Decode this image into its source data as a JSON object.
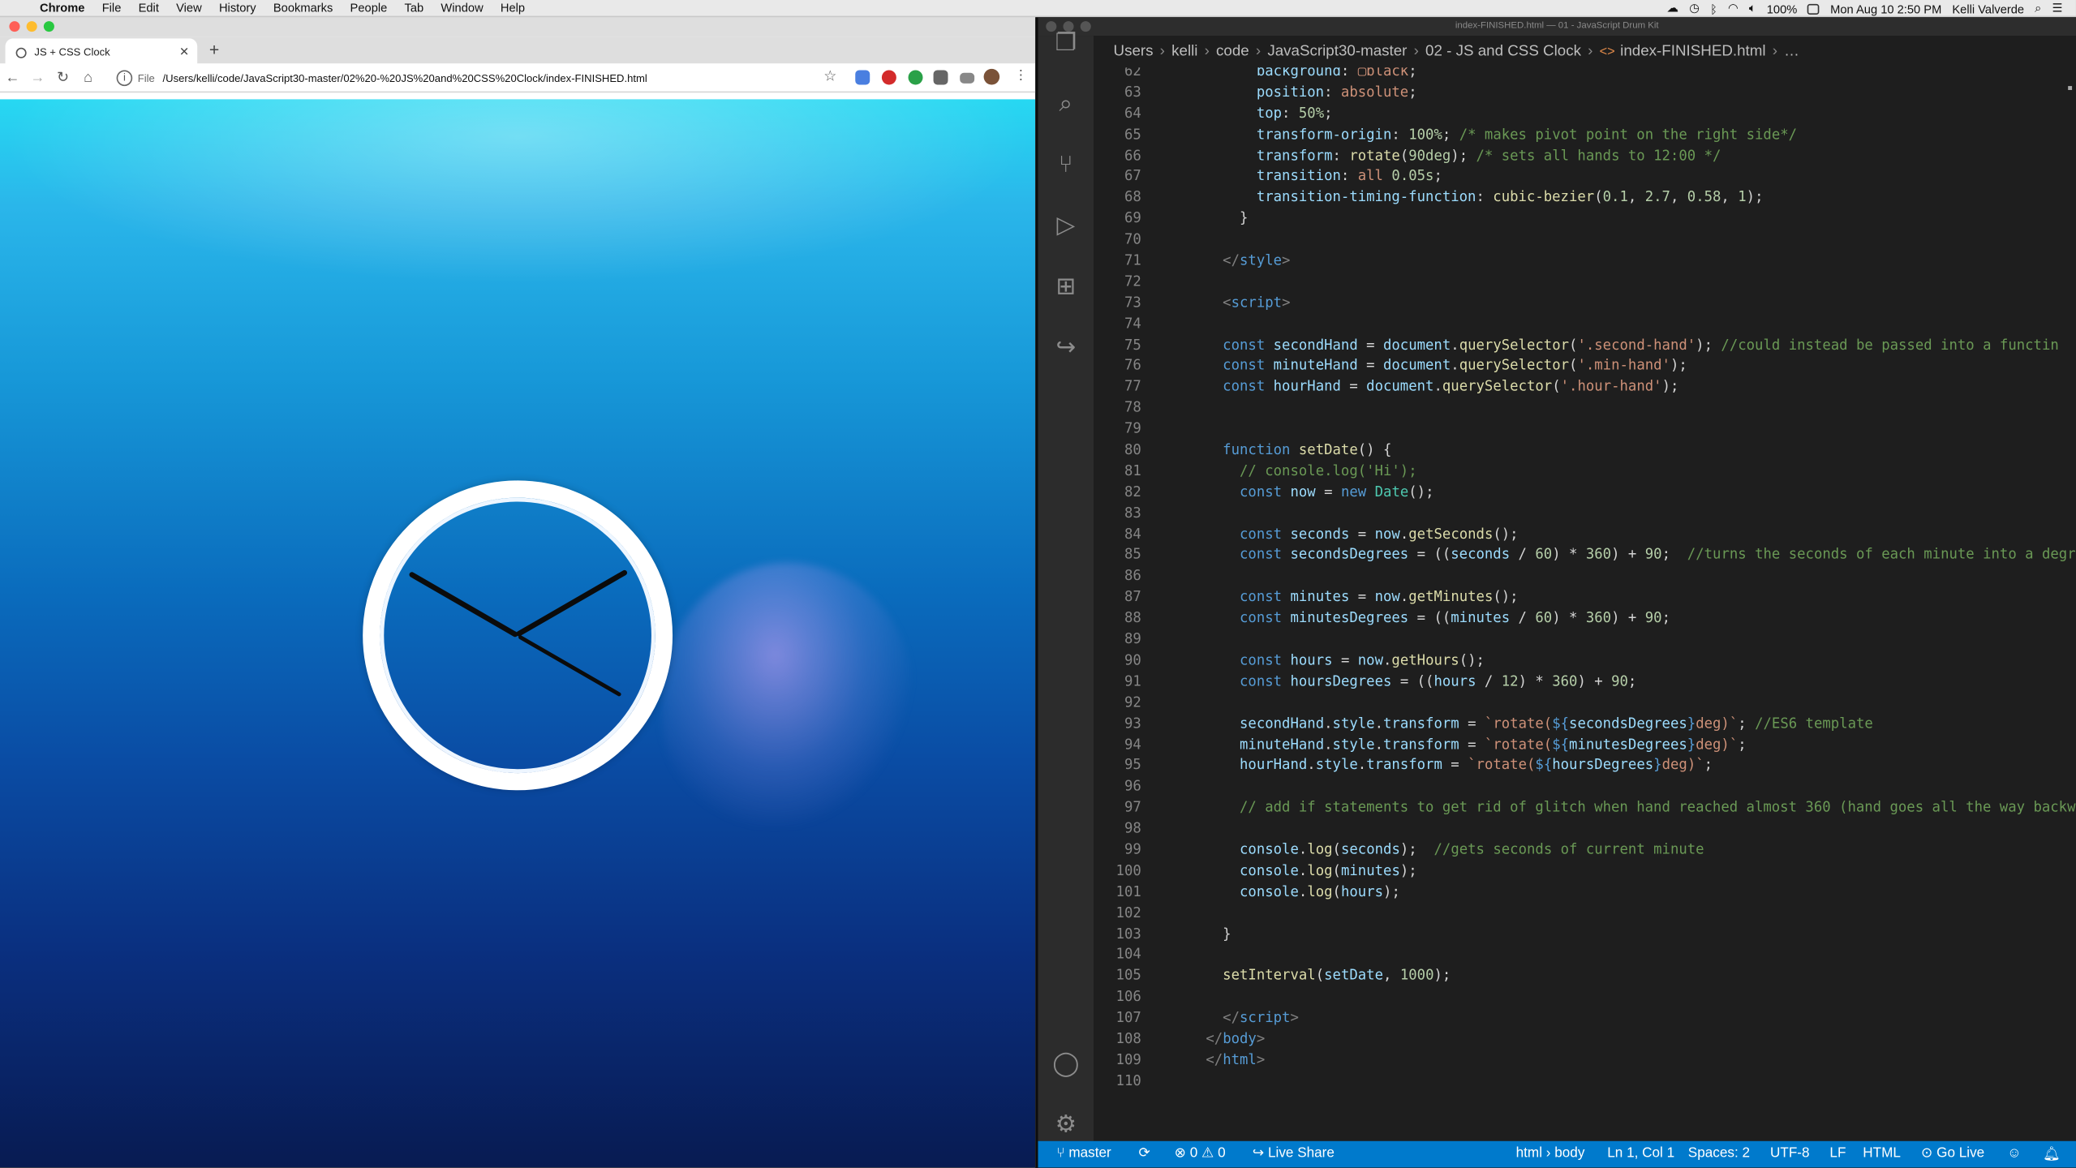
{
  "menubar": {
    "app": "Chrome",
    "items": [
      "File",
      "Edit",
      "View",
      "History",
      "Bookmarks",
      "People",
      "Tab",
      "Window",
      "Help"
    ],
    "battery": "100%",
    "datetime": "Mon Aug 10  2:50 PM",
    "user": "Kelli Valverde"
  },
  "chrome": {
    "tab_title": "JS + CSS Clock",
    "url_scheme": "File",
    "url": "/Users/kelli/code/JavaScript30-master/02%20-%20JS%20and%20CSS%20Clock/index-FINISHED.html",
    "clock": {
      "hour_hand_deg": 150,
      "minute_hand_deg": 390,
      "second_hand_deg": 210
    }
  },
  "vscode": {
    "window_title": "index-FINISHED.html — 01 - JavaScript Drum Kit",
    "breadcrumb": [
      "Users",
      "kelli",
      "code",
      "JavaScript30-master",
      "02 - JS and CSS Clock",
      "index-FINISHED.html",
      "…"
    ],
    "code_lines": [
      {
        "n": "62",
        "html": "        <span class=\"prop\">background</span>: <span class=\"val\">▢black</span>;"
      },
      {
        "n": "63",
        "html": "        <span class=\"prop\">position</span>: <span class=\"val\">absolute</span>;"
      },
      {
        "n": "64",
        "html": "        <span class=\"prop\">top</span>: <span class=\"num\">50%</span>;"
      },
      {
        "n": "65",
        "html": "        <span class=\"prop\">transform-origin</span>: <span class=\"num\">100%</span>; <span class=\"cm\">/* makes pivot point on the right side*/</span>"
      },
      {
        "n": "66",
        "html": "        <span class=\"prop\">transform</span>: <span class=\"fn\">rotate</span>(<span class=\"num\">90deg</span>); <span class=\"cm\">/* sets all hands to 12:00 */</span>"
      },
      {
        "n": "67",
        "html": "        <span class=\"prop\">transition</span>: <span class=\"val\">all</span> <span class=\"num\">0.05s</span>;"
      },
      {
        "n": "68",
        "html": "        <span class=\"prop\">transition-timing-function</span>: <span class=\"fn\">cubic-bezier</span>(<span class=\"num\">0.1</span>, <span class=\"num\">2.7</span>, <span class=\"num\">0.58</span>, <span class=\"num\">1</span>);"
      },
      {
        "n": "69",
        "html": "      }"
      },
      {
        "n": "70",
        "html": ""
      },
      {
        "n": "71",
        "html": "    <span class=\"tag\">&lt;/</span><span class=\"tn\">style</span><span class=\"tag\">&gt;</span>"
      },
      {
        "n": "72",
        "html": ""
      },
      {
        "n": "73",
        "html": "    <span class=\"tag\">&lt;</span><span class=\"tn\">script</span><span class=\"tag\">&gt;</span>"
      },
      {
        "n": "74",
        "html": ""
      },
      {
        "n": "75",
        "html": "    <span class=\"kw\">const</span> <span class=\"var\">secondHand</span> = <span class=\"var\">document</span>.<span class=\"fn\">querySelector</span>(<span class=\"str\">'.second-hand'</span>); <span class=\"cm\">//could instead be passed into a functin</span>"
      },
      {
        "n": "76",
        "html": "    <span class=\"kw\">const</span> <span class=\"var\">minuteHand</span> = <span class=\"var\">document</span>.<span class=\"fn\">querySelector</span>(<span class=\"str\">'.min-hand'</span>);"
      },
      {
        "n": "77",
        "html": "    <span class=\"kw\">const</span> <span class=\"var\">hourHand</span> = <span class=\"var\">document</span>.<span class=\"fn\">querySelector</span>(<span class=\"str\">'.hour-hand'</span>);"
      },
      {
        "n": "78",
        "html": ""
      },
      {
        "n": "79",
        "html": ""
      },
      {
        "n": "80",
        "html": "    <span class=\"kw\">function</span> <span class=\"fn\">setDate</span>() {"
      },
      {
        "n": "81",
        "html": "      <span class=\"cm\">// console.log('Hi');</span>"
      },
      {
        "n": "82",
        "html": "      <span class=\"kw\">const</span> <span class=\"var\">now</span> = <span class=\"kw\">new</span> <span class=\"typ\">Date</span>();"
      },
      {
        "n": "83",
        "html": ""
      },
      {
        "n": "84",
        "html": "      <span class=\"kw\">const</span> <span class=\"var\">seconds</span> = <span class=\"var\">now</span>.<span class=\"fn\">getSeconds</span>();"
      },
      {
        "n": "85",
        "html": "      <span class=\"kw\">const</span> <span class=\"var\">secondsDegrees</span> = ((<span class=\"var\">seconds</span> / <span class=\"num\">60</span>) * <span class=\"num\">360</span>) + <span class=\"num\">90</span>;  <span class=\"cm\">//turns the seconds of each minute into a degree of the circle</span>"
      },
      {
        "n": "86",
        "html": ""
      },
      {
        "n": "87",
        "html": "      <span class=\"kw\">const</span> <span class=\"var\">minutes</span> = <span class=\"var\">now</span>.<span class=\"fn\">getMinutes</span>();"
      },
      {
        "n": "88",
        "html": "      <span class=\"kw\">const</span> <span class=\"var\">minutesDegrees</span> = ((<span class=\"var\">minutes</span> / <span class=\"num\">60</span>) * <span class=\"num\">360</span>) + <span class=\"num\">90</span>;"
      },
      {
        "n": "89",
        "html": ""
      },
      {
        "n": "90",
        "html": "      <span class=\"kw\">const</span> <span class=\"var\">hours</span> = <span class=\"var\">now</span>.<span class=\"fn\">getHours</span>();"
      },
      {
        "n": "91",
        "html": "      <span class=\"kw\">const</span> <span class=\"var\">hoursDegrees</span> = ((<span class=\"var\">hours</span> / <span class=\"num\">12</span>) * <span class=\"num\">360</span>) + <span class=\"num\">90</span>;"
      },
      {
        "n": "92",
        "html": ""
      },
      {
        "n": "93",
        "html": "      <span class=\"var\">secondHand</span>.<span class=\"var\">style</span>.<span class=\"var\">transform</span> = <span class=\"str\">`rotate(</span><span class=\"kw\">${</span><span class=\"var\">secondsDegrees</span><span class=\"kw\">}</span><span class=\"str\">deg)`</span>; <span class=\"cm\">//ES6 template</span>"
      },
      {
        "n": "94",
        "html": "      <span class=\"var\">minuteHand</span>.<span class=\"var\">style</span>.<span class=\"var\">transform</span> = <span class=\"str\">`rotate(</span><span class=\"kw\">${</span><span class=\"var\">minutesDegrees</span><span class=\"kw\">}</span><span class=\"str\">deg)`</span>;"
      },
      {
        "n": "95",
        "html": "      <span class=\"var\">hourHand</span>.<span class=\"var\">style</span>.<span class=\"var\">transform</span> = <span class=\"str\">`rotate(</span><span class=\"kw\">${</span><span class=\"var\">hoursDegrees</span><span class=\"kw\">}</span><span class=\"str\">deg)`</span>;"
      },
      {
        "n": "96",
        "html": ""
      },
      {
        "n": "97",
        "html": "      <span class=\"cm\">// add if statements to get rid of glitch when hand reached almost 360 (hand goes all the way backwards</span>"
      },
      {
        "n": "98",
        "html": ""
      },
      {
        "n": "99",
        "html": "      <span class=\"var\">console</span>.<span class=\"fn\">log</span>(<span class=\"var\">seconds</span>);  <span class=\"cm\">//gets seconds of current minute</span>"
      },
      {
        "n": "100",
        "html": "      <span class=\"var\">console</span>.<span class=\"fn\">log</span>(<span class=\"var\">minutes</span>);"
      },
      {
        "n": "101",
        "html": "      <span class=\"var\">console</span>.<span class=\"fn\">log</span>(<span class=\"var\">hours</span>);"
      },
      {
        "n": "102",
        "html": ""
      },
      {
        "n": "103",
        "html": "    }"
      },
      {
        "n": "104",
        "html": ""
      },
      {
        "n": "105",
        "html": "    <span class=\"fn\">setInterval</span>(<span class=\"var\">setDate</span>, <span class=\"num\">1000</span>);"
      },
      {
        "n": "106",
        "html": ""
      },
      {
        "n": "107",
        "html": "    <span class=\"tag\">&lt;/</span><span class=\"tn\">script</span><span class=\"tag\">&gt;</span>"
      },
      {
        "n": "108",
        "html": "  <span class=\"tag\">&lt;/</span><span class=\"tn\">body</span><span class=\"tag\">&gt;</span>"
      },
      {
        "n": "109",
        "html": "  <span class=\"tag\">&lt;/</span><span class=\"tn\">html</span><span class=\"tag\">&gt;</span>"
      },
      {
        "n": "110",
        "html": ""
      }
    ],
    "status": {
      "branch": "master",
      "problems": "⊗ 0 ⚠ 0",
      "live_share": "Live Share",
      "context": "html › body",
      "position": "Ln 1, Col 1",
      "spaces": "Spaces: 2",
      "encoding": "UTF-8",
      "eol": "LF",
      "language": "HTML",
      "go_live": "Go Live"
    }
  }
}
